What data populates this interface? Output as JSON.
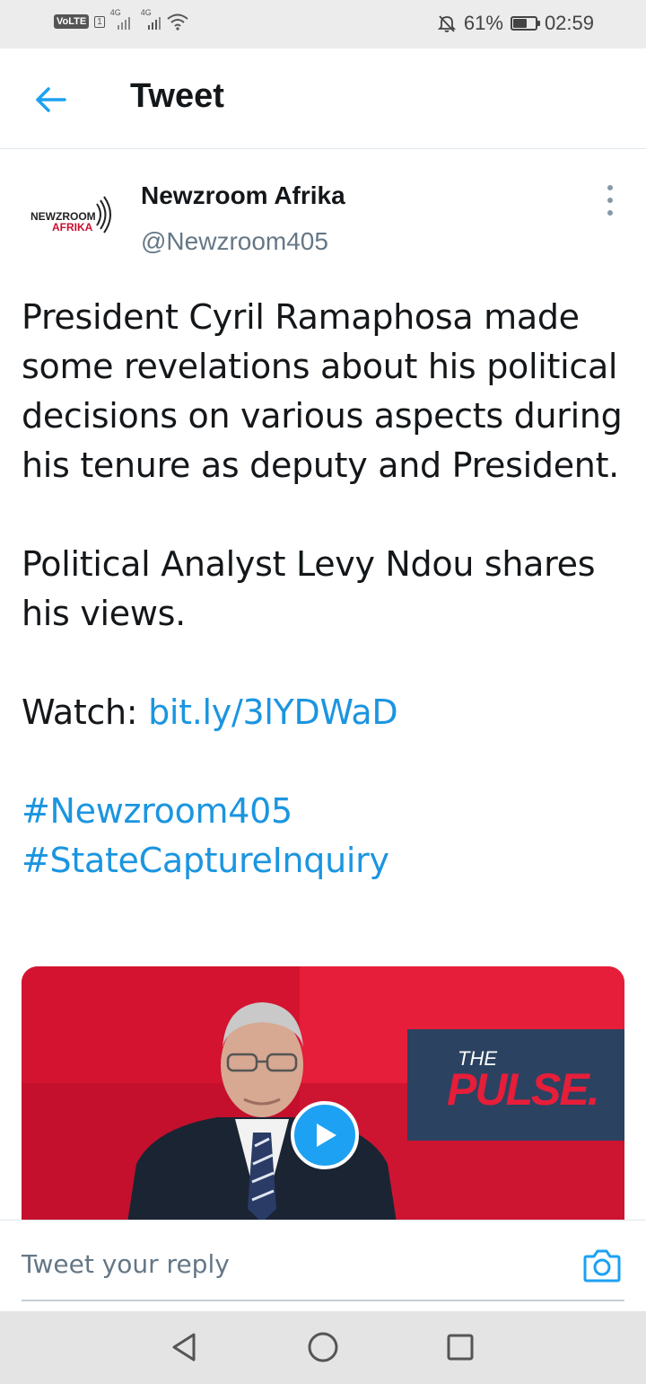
{
  "status_bar": {
    "network_badge": "VoLTE",
    "sim_slot": "1",
    "net1": "4G",
    "net2": "4G",
    "battery_text": "61%",
    "battery_level": 0.61,
    "time": "02:59"
  },
  "header": {
    "title": "Tweet"
  },
  "tweet": {
    "author_name": "Newzroom Afrika",
    "author_handle": "@Newzroom405",
    "paragraph1": "President Cyril Ramaphosa made some revelations about his political decisions on various aspects during his tenure as deputy and President.",
    "paragraph2": "Political Analyst Levy Ndou shares his views.",
    "watch_label": "Watch: ",
    "watch_link": "bit.ly/3lYDWaD",
    "hashtag1": "#Newzroom405",
    "hashtag2": "#StateCaptureInquiry",
    "media": {
      "brand_line1": "THE",
      "brand_line2": "PULSE."
    }
  },
  "reply": {
    "placeholder": "Tweet your reply"
  },
  "logo_text": [
    "NEWZROOM",
    "AFRIKA"
  ],
  "colors": {
    "accent": "#1da1f2",
    "link": "#1b95e0",
    "brand_red": "#e61e3a"
  }
}
